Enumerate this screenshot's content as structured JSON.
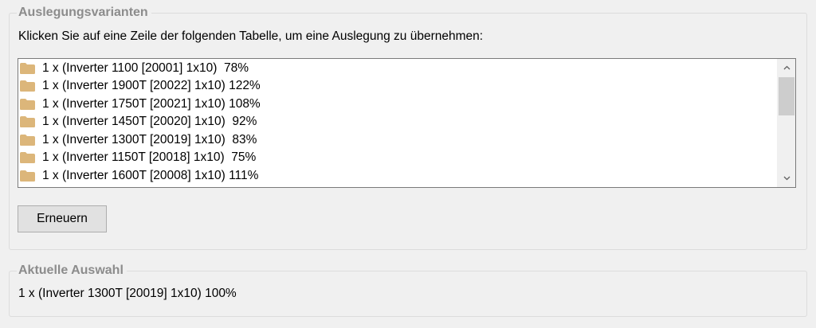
{
  "variants": {
    "legend": "Auslegungsvarianten",
    "instruction": "Klicken Sie auf eine Zeile der folgenden Tabelle, um eine Auslegung zu übernehmen:",
    "items": [
      {
        "label": "1 x (Inverter 1100 [20001] 1x10)  78%"
      },
      {
        "label": "1 x (Inverter 1900T [20022] 1x10) 122%"
      },
      {
        "label": "1 x (Inverter 1750T [20021] 1x10) 108%"
      },
      {
        "label": "1 x (Inverter 1450T [20020] 1x10)  92%"
      },
      {
        "label": "1 x (Inverter 1300T [20019] 1x10)  83%"
      },
      {
        "label": "1 x (Inverter 1150T [20018] 1x10)  75%"
      },
      {
        "label": "1 x (Inverter 1600T [20008] 1x10) 111%"
      }
    ],
    "item_icon": "folder-icon",
    "refresh_button": "Erneuern"
  },
  "selection": {
    "legend": "Aktuelle Auswahl",
    "value": "1 x (Inverter 1300T [20019] 1x10) 100%"
  },
  "colors": {
    "folder": "#dcb67a",
    "legend": "#8c8c8c",
    "background": "#f0f0f0"
  }
}
